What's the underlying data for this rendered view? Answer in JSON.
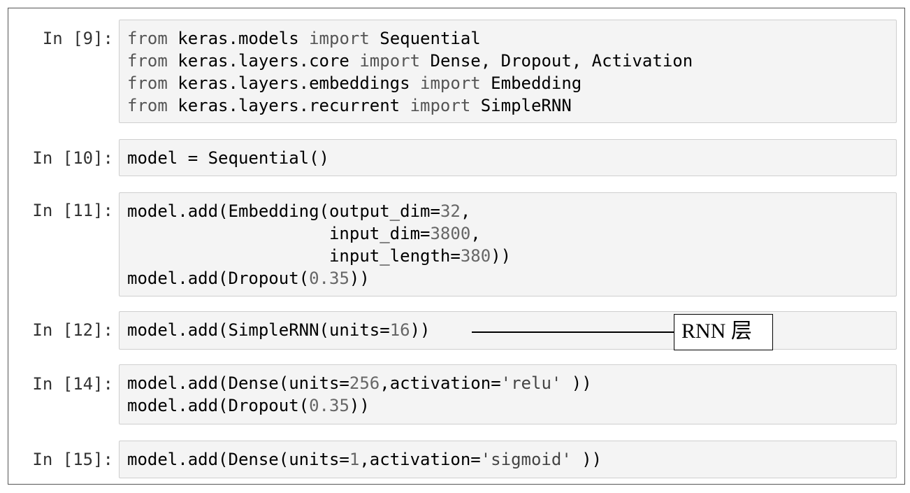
{
  "cells": [
    {
      "prompt": "In [9]:",
      "lines": [
        [
          {
            "t": "from",
            "c": "kw"
          },
          {
            "t": " keras.models "
          },
          {
            "t": "import",
            "c": "kw"
          },
          {
            "t": " Sequential"
          }
        ],
        [
          {
            "t": "from",
            "c": "kw"
          },
          {
            "t": " keras.layers.core "
          },
          {
            "t": "import",
            "c": "kw"
          },
          {
            "t": " Dense, Dropout, Activation"
          }
        ],
        [
          {
            "t": "from",
            "c": "kw"
          },
          {
            "t": " keras.layers.embeddings "
          },
          {
            "t": "import",
            "c": "kw"
          },
          {
            "t": " Embedding"
          }
        ],
        [
          {
            "t": "from",
            "c": "kw"
          },
          {
            "t": " keras.layers.recurrent "
          },
          {
            "t": "import",
            "c": "kw"
          },
          {
            "t": " SimpleRNN"
          }
        ]
      ]
    },
    {
      "prompt": "In [10]:",
      "lines": [
        [
          {
            "t": "model = Sequential()"
          }
        ]
      ]
    },
    {
      "prompt": "In [11]:",
      "lines": [
        [
          {
            "t": "model.add(Embedding(output_dim="
          },
          {
            "t": "32",
            "c": "num"
          },
          {
            "t": ","
          }
        ],
        [
          {
            "t": "                    input_dim="
          },
          {
            "t": "3800",
            "c": "num"
          },
          {
            "t": ","
          }
        ],
        [
          {
            "t": "                    input_length="
          },
          {
            "t": "380",
            "c": "num"
          },
          {
            "t": "))"
          }
        ],
        [
          {
            "t": "model.add(Dropout("
          },
          {
            "t": "0.35",
            "c": "num"
          },
          {
            "t": "))"
          }
        ]
      ]
    },
    {
      "prompt": "In [12]:",
      "lines": [
        [
          {
            "t": "model.add(SimpleRNN(units="
          },
          {
            "t": "16",
            "c": "num"
          },
          {
            "t": "))"
          }
        ]
      ]
    },
    {
      "prompt": "In [14]:",
      "lines": [
        [
          {
            "t": "model.add(Dense(units="
          },
          {
            "t": "256",
            "c": "num"
          },
          {
            "t": ",activation="
          },
          {
            "t": "'relu'",
            "c": "str"
          },
          {
            "t": " ))"
          }
        ],
        [
          {
            "t": "model.add(Dropout("
          },
          {
            "t": "0.35",
            "c": "num"
          },
          {
            "t": "))"
          }
        ]
      ]
    },
    {
      "prompt": "In [15]:",
      "lines": [
        [
          {
            "t": "model.add(Dense(units="
          },
          {
            "t": "1",
            "c": "num"
          },
          {
            "t": ",activation="
          },
          {
            "t": "'sigmoid'",
            "c": "str"
          },
          {
            "t": " ))"
          }
        ]
      ]
    }
  ],
  "annotation": {
    "label": "RNN 层"
  }
}
